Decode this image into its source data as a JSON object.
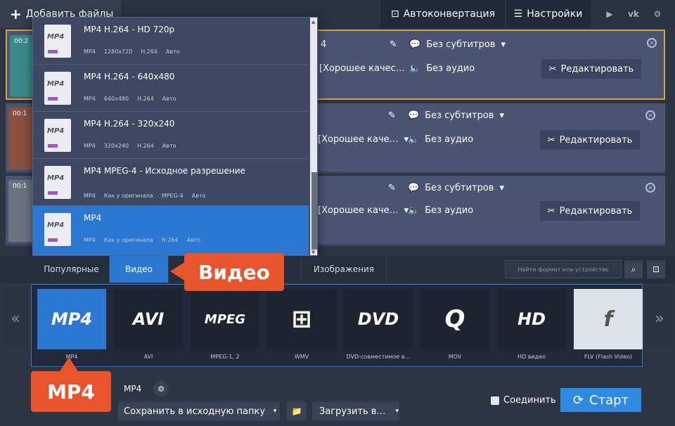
{
  "topbar": {
    "add_files": "Добавить файлы",
    "autoconvert": "Автоконвертация",
    "settings": "Настройки",
    "social": [
      "▶",
      "vk",
      "⚙"
    ]
  },
  "files": [
    {
      "duration": "00:2",
      "title": "4",
      "subtitles": "Без субтитров",
      "quality": "[Хорошее качес…",
      "audio": "Без аудио",
      "edit": "Редактировать"
    },
    {
      "duration": "00:1",
      "title": "",
      "subtitles": "Без субтитров",
      "quality": "[Хорошее каче…",
      "audio": "Без аудио",
      "edit": "Редактировать"
    },
    {
      "duration": "00:1",
      "title": "",
      "subtitles": "Без субтитров",
      "quality": "[Хорошее каче…",
      "audio": "Без аудио",
      "edit": "Редактировать"
    }
  ],
  "presets": [
    {
      "icon_text": "MP4",
      "title": "MP4 H.264 - HD 720p",
      "meta": [
        "MP4",
        "1280x720",
        "H.264",
        "Авто"
      ]
    },
    {
      "icon_text": "MP4",
      "title": "MP4 H.264 - 640x480",
      "meta": [
        "MP4",
        "640x480",
        "H.264",
        "Авто"
      ]
    },
    {
      "icon_text": "MP4",
      "title": "MP4 H.264 - 320x240",
      "meta": [
        "MP4",
        "320x240",
        "H.264",
        "Авто"
      ]
    },
    {
      "icon_text": "MP4",
      "title": "MP4 MPEG-4 - Исходное разрешение",
      "meta": [
        "MP4",
        "Как у оригинала",
        "MPEG-4",
        "Авто"
      ]
    },
    {
      "icon_text": "MP4",
      "title": "MP4",
      "meta": [
        "MP4",
        "Как у оригинала",
        "H.264",
        "Авто"
      ]
    }
  ],
  "tabs": [
    {
      "label": "Популярные"
    },
    {
      "label": "Видео"
    },
    {
      "label": "Изображения"
    }
  ],
  "search": {
    "placeholder": "Найти формат или устройство"
  },
  "formats": [
    {
      "logo": "MP4",
      "label": "MP4"
    },
    {
      "logo": "AVI",
      "label": "AVI"
    },
    {
      "logo": "MPEG",
      "label": "MPEG-1, 2"
    },
    {
      "logo": "⊞",
      "label": "WMV"
    },
    {
      "logo": "DVD",
      "label": "DVD-совместимое в…"
    },
    {
      "logo": "Q",
      "label": "MOV"
    },
    {
      "logo": "HD",
      "label": "HD видео"
    },
    {
      "logo": "f",
      "label": "FLV (Flash Video)"
    }
  ],
  "bottom": {
    "format_label": ":",
    "format_value": "MP4",
    "folder": "Сохранить в исходную папку",
    "upload": "Загрузить в…",
    "join": "Соединить",
    "start": "Старт"
  },
  "callouts": {
    "video": "Видео",
    "mp4": "MP4"
  }
}
